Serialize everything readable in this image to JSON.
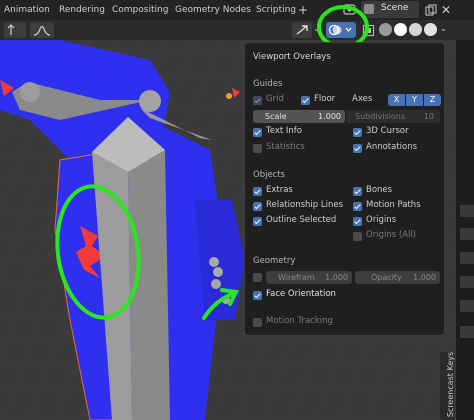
{
  "topbar": {
    "tabs": [
      "Animation",
      "Rendering",
      "Compositing",
      "Geometry Nodes",
      "Scripting"
    ],
    "add_label": "+",
    "scene_label": "Scene"
  },
  "overlay_panel": {
    "title": "Viewport Overlays",
    "guides": {
      "heading": "Guides",
      "grid": "Grid",
      "floor": "Floor",
      "axes": "Axes",
      "axis_x": "X",
      "axis_y": "Y",
      "axis_z": "Z",
      "scale_label": "Scale",
      "scale_value": "1.000",
      "subdivisions_label": "Subdivisions",
      "subdivisions_value": "10",
      "text_info": "Text Info",
      "cursor_3d": "3D Cursor",
      "statistics": "Statistics",
      "annotations": "Annotations"
    },
    "objects": {
      "heading": "Objects",
      "extras": "Extras",
      "bones": "Bones",
      "relationship_lines": "Relationship Lines",
      "motion_paths": "Motion Paths",
      "outline_selected": "Outline Selected",
      "origins": "Origins",
      "origins_all": "Origins (All)"
    },
    "geometry": {
      "heading": "Geometry",
      "wireframe_label": "Wirefram",
      "wireframe_value": "1.000",
      "opacity_label": "Opacity",
      "opacity_value": "1.000",
      "face_orientation": "Face Orientation",
      "motion_tracking": "Motion Tracking"
    }
  },
  "side_tab": "Screencast Keys",
  "colors": {
    "accent": "#4772b3",
    "annotation_green": "#2be61c",
    "face_back": "#2f2ff0",
    "face_back_hint": "#f23a3a"
  }
}
